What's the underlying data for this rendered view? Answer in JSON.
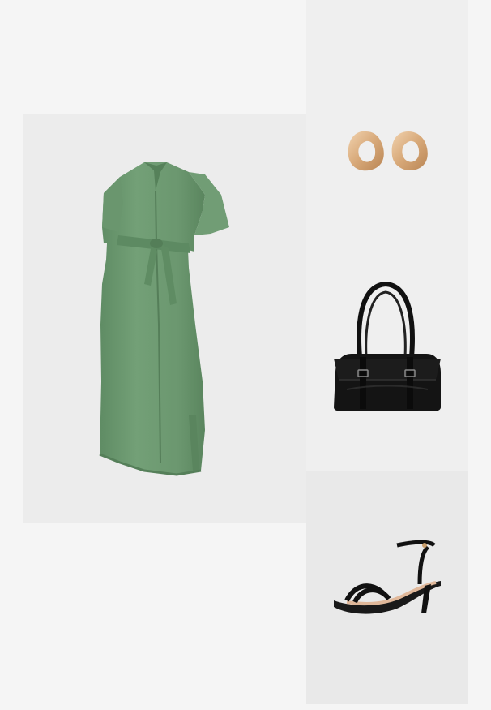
{
  "outfit": {
    "items": [
      {
        "item": "dress",
        "color": "#6e9a72",
        "icon": "maternity-shirt-dress"
      },
      {
        "item": "earrings",
        "color": "#d7a878",
        "icon": "gold-knot-earrings"
      },
      {
        "item": "handbag",
        "color": "#141414",
        "icon": "black-shoulder-bag"
      },
      {
        "item": "sandals",
        "color": "#1a1a1a",
        "icon": "black-strappy-heeled-sandal"
      }
    ],
    "colors": {
      "page_background": "#f5f5f5",
      "tile_background": "#ececec"
    }
  }
}
